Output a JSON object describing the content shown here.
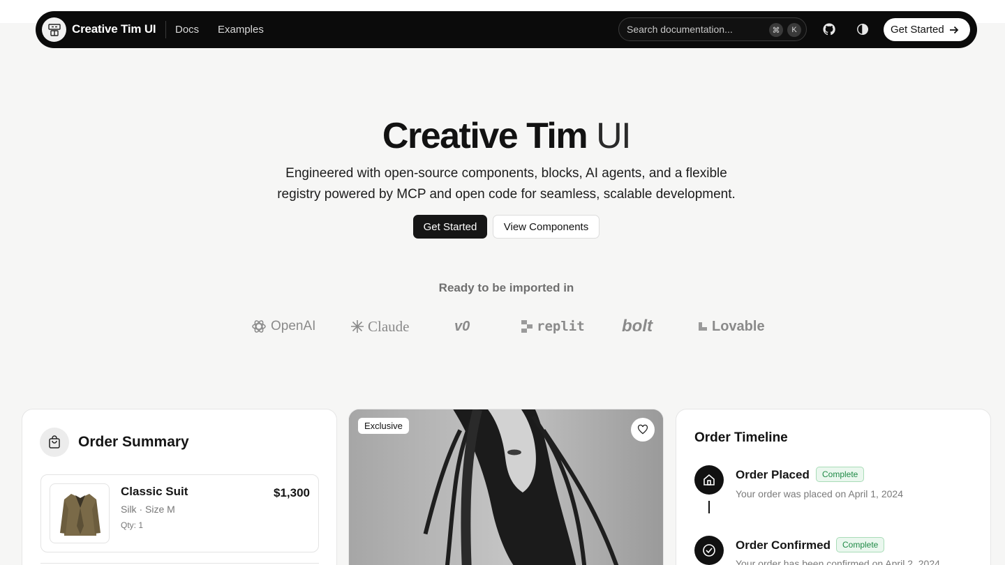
{
  "navbar": {
    "brand": "Creative Tim UI",
    "links": [
      "Docs",
      "Examples"
    ],
    "search_placeholder": "Search documentation...",
    "shortcut": [
      "⌘",
      "K"
    ],
    "cta": "Get Started",
    "icons": [
      "logo-icon",
      "github-icon",
      "theme-toggle-icon",
      "arrow-right-icon"
    ]
  },
  "hero": {
    "title_bold": "Creative Tim",
    "title_light": "UI",
    "subtitle_line1": "Engineered with open-source components, blocks, AI agents, and a flexible",
    "subtitle_line2": "registry powered by MCP and open code for seamless, scalable development.",
    "primary_button": "Get Started",
    "secondary_button": "View Components"
  },
  "integrations": {
    "heading": "Ready to be imported in",
    "logos": [
      "OpenAI",
      "Claude",
      "v0",
      "replit",
      "bolt",
      "Lovable"
    ]
  },
  "order_summary": {
    "title": "Order Summary",
    "item": {
      "name": "Classic Suit",
      "meta": "Silk · Size M",
      "qty": "Qty: 1",
      "price": "$1,300"
    }
  },
  "product_card": {
    "badge": "Exclusive"
  },
  "timeline": {
    "title": "Order Timeline",
    "steps": [
      {
        "name": "Order Placed",
        "status": "Complete",
        "desc": "Your order was placed on April 1, 2024"
      },
      {
        "name": "Order Confirmed",
        "status": "Complete",
        "desc": "Your order has been confirmed on April 2, 2024"
      }
    ]
  },
  "colors": {
    "background": "#f6f6f5",
    "navbar": "#0b0b0b",
    "badge_green": "#1f8a46"
  }
}
